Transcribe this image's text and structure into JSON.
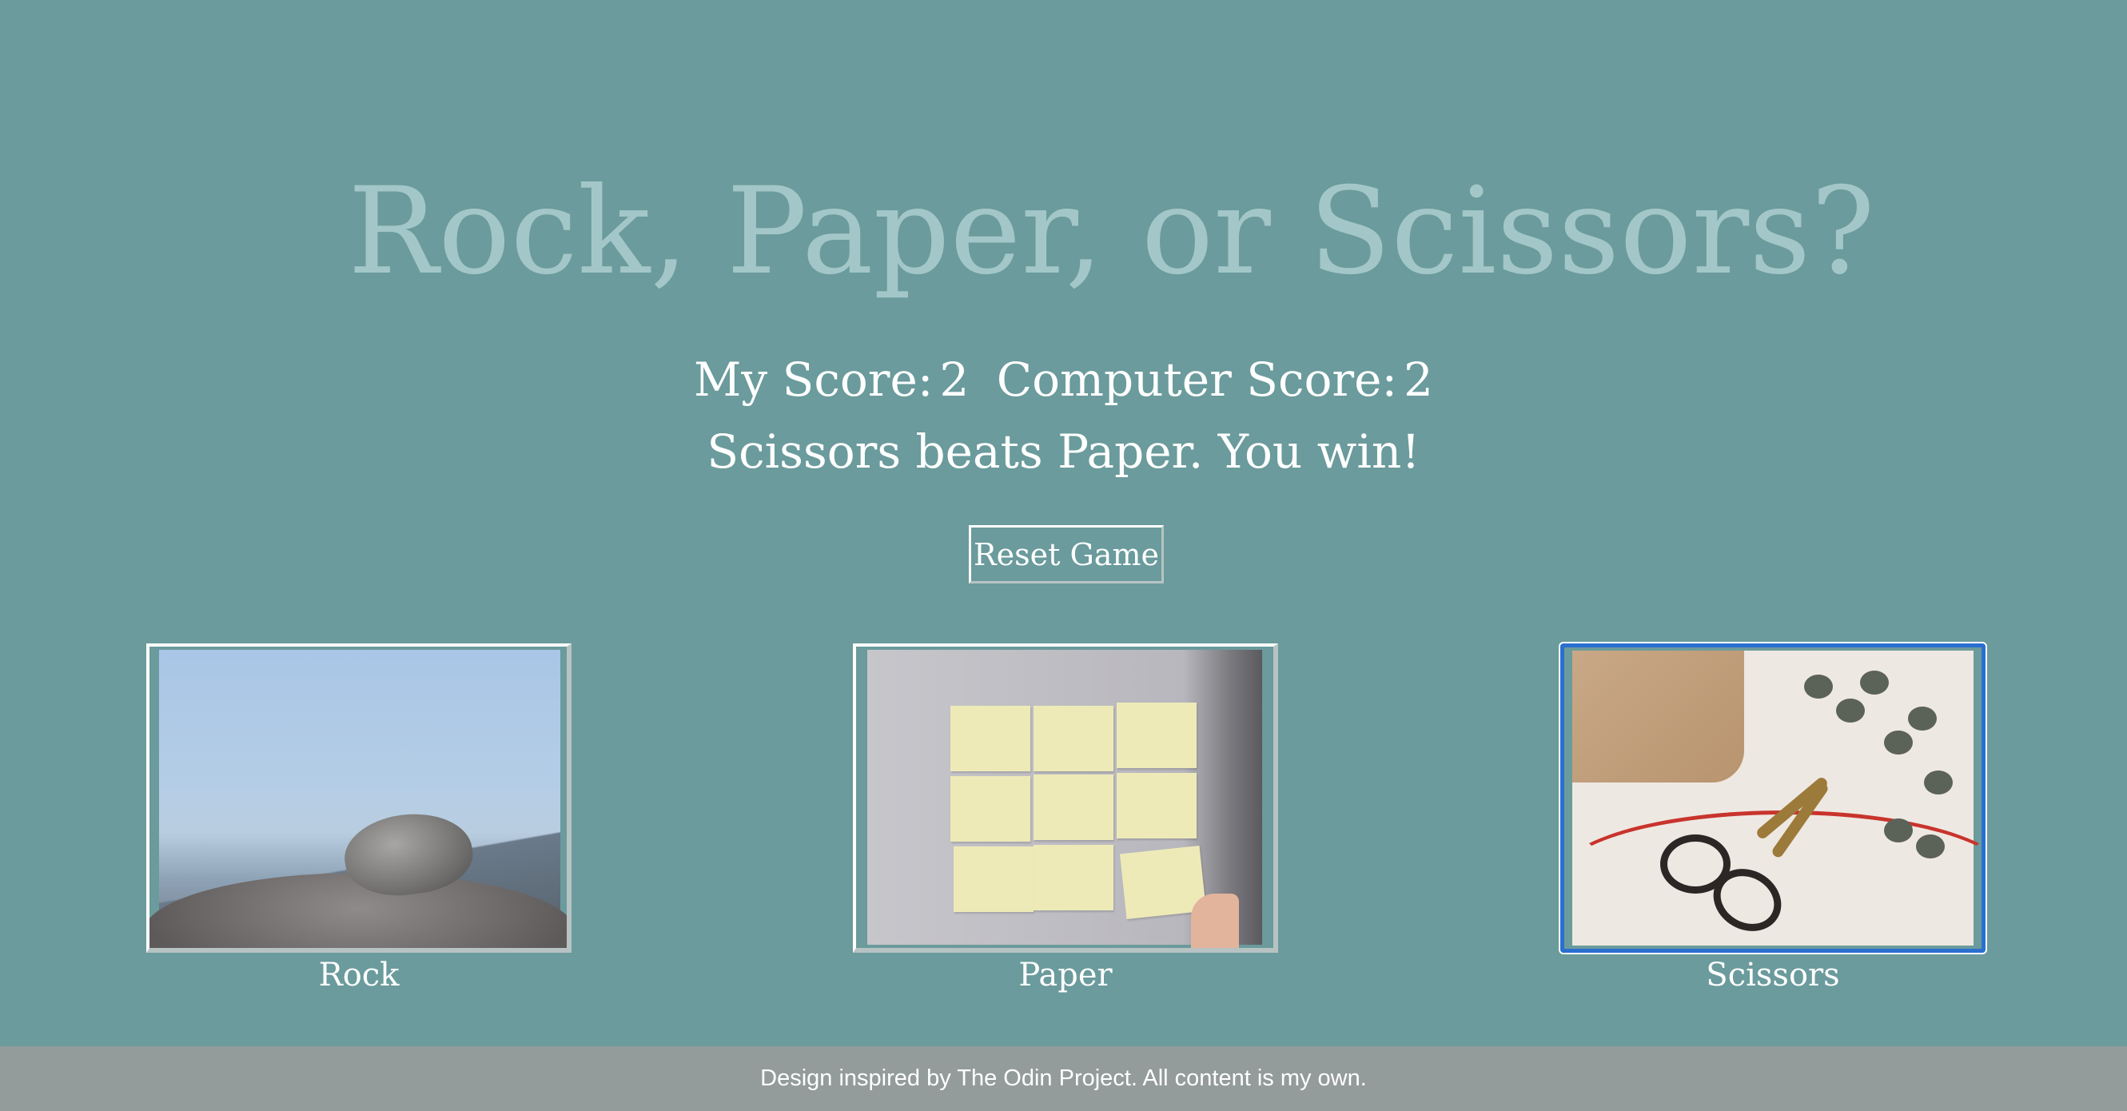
{
  "title": "Rock, Paper, or Scissors?",
  "score": {
    "player_label": "My Score:",
    "player_value": "2",
    "computer_label": "Computer Score:",
    "computer_value": "2"
  },
  "result_text": "Scissors beats Paper. You win!",
  "reset_label": "Reset Game",
  "choices": [
    {
      "label": "Rock",
      "image": "rock-on-stone-photo"
    },
    {
      "label": "Paper",
      "image": "sticky-notes-photo"
    },
    {
      "label": "Scissors",
      "image": "scissors-and-ribbon-photo",
      "selected": true
    }
  ],
  "footer_text": "Design inspired by The Odin Project. All content is my own.",
  "colors": {
    "background": "#6b9b9c",
    "title": "#a3c7c8",
    "text": "#ffffff",
    "footer_bg": "#939b9b",
    "selected_border": "#2a6fd0"
  }
}
